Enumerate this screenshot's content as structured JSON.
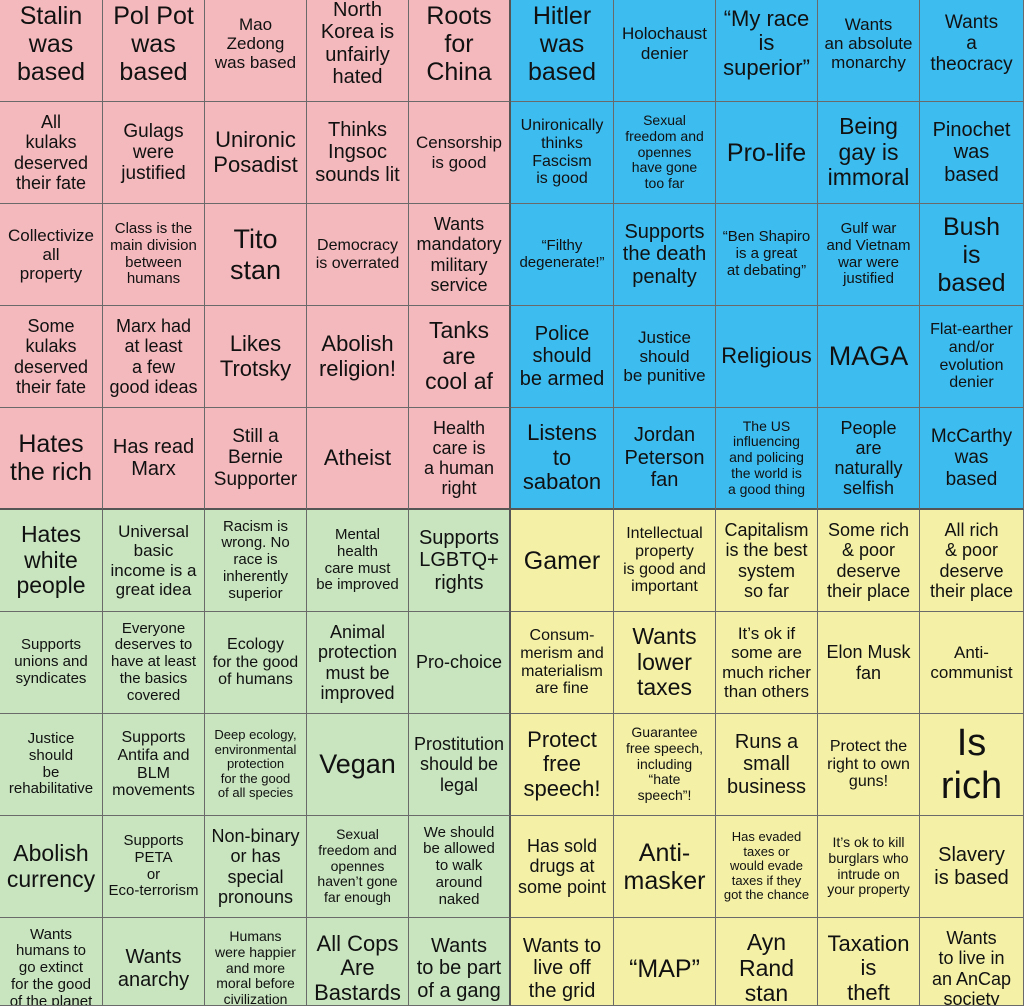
{
  "colors": {
    "red": "#f4b9bd",
    "blue": "#3dbcf0",
    "green": "#c8e5bf",
    "yellow": "#f4f1a7"
  },
  "rows": [
    [
      "Stalin\nwas\nbased",
      "Pol Pot\nwas\nbased",
      "Mao\nZedong\nwas based",
      "North\nKorea is\nunfairly\nhated",
      "Roots\nfor\nChina",
      "Hitler\nwas\nbased",
      "Holochaust\ndenier",
      "“My race\nis\nsuperior”",
      "Wants\nan absolute\nmonarchy",
      "Wants\na\ntheocracy"
    ],
    [
      "All\nkulaks\ndeserved\ntheir fate",
      "Gulags\nwere\njustified",
      "Unironic\nPosadist",
      "Thinks\nIngsoc\nsounds lit",
      "Censorship\nis good",
      "Unironically\nthinks\nFascism\nis good",
      "Sexual\nfreedom and\nopennes\nhave gone\ntoo far",
      "Pro-life",
      "Being\ngay is\nimmoral",
      "Pinochet\nwas\nbased"
    ],
    [
      "Collectivize\nall\nproperty",
      "Class is the\nmain division\nbetween\nhumans",
      "Tito\nstan",
      "Democracy\nis overrated",
      "Wants\nmandatory\nmilitary\nservice",
      "“Filthy\ndegenerate!”",
      "Supports\nthe death\npenalty",
      "“Ben Shapiro\nis a great\nat debating”",
      "Gulf war\nand Vietnam\nwar were\njustified",
      "Bush\nis\nbased"
    ],
    [
      "Some\nkulaks\ndeserved\ntheir fate",
      "Marx had\nat least\na few\ngood ideas",
      "Likes\nTrotsky",
      "Abolish\nreligion!",
      "Tanks\nare\ncool af",
      "Police\nshould\nbe armed",
      "Justice\nshould\nbe punitive",
      "Religious",
      "MAGA",
      "Flat-earther\nand/or\nevolution\ndenier"
    ],
    [
      "Hates\nthe rich",
      "Has read\nMarx",
      "Still a\nBernie\nSupporter",
      "Atheist",
      "Health\ncare is\na human\nright",
      "Listens\nto\nsabaton",
      "Jordan\nPeterson\nfan",
      "The US\ninfluencing\nand policing\nthe world is\na good thing",
      "People\nare\nnaturally\nselfish",
      "McCarthy\nwas\nbased"
    ],
    [
      "Hates\nwhite\npeople",
      "Universal\nbasic\nincome is a\ngreat idea",
      "Racism is\nwrong. No\nrace is\ninherently\nsuperior",
      "Mental\nhealth\ncare must\nbe improved",
      "Supports\nLGBTQ+\nrights",
      "Gamer",
      "Intellectual\nproperty\nis good and\nimportant",
      "Capitalism\nis the best\nsystem\nso far",
      "Some rich\n& poor\ndeserve\ntheir place",
      "All rich\n& poor\ndeserve\ntheir place"
    ],
    [
      "Supports\nunions and\nsyndicates",
      "Everyone\ndeserves to\nhave at least\nthe basics\ncovered",
      "Ecology\nfor the good\nof humans",
      "Animal\nprotection\nmust be\nimproved",
      "Pro-choice",
      "Consum-\nmerism and\nmaterialism\nare fine",
      "Wants\nlower\ntaxes",
      "It’s ok if\nsome are\nmuch richer\nthan others",
      "Elon Musk\nfan",
      "Anti-\ncommunist"
    ],
    [
      "Justice\nshould\nbe\nrehabilitative",
      "Supports\nAntifa and\nBLM\nmovements",
      "Deep ecology,\nenvironmental\nprotection\nfor the good\nof all species",
      "Vegan",
      "Prostitution\nshould be\nlegal",
      "Protect\nfree\nspeech!",
      "Guarantee\nfree speech,\nincluding\n“hate\nspeech”!",
      "Runs a\nsmall\nbusiness",
      "Protect the\nright to own\nguns!",
      "Is\nrich"
    ],
    [
      "Abolish\ncurrency",
      "Supports\nPETA\nor\nEco-terrorism",
      "Non-binary\nor has\nspecial\npronouns",
      "Sexual\nfreedom and\nopennes\nhaven’t gone\nfar enough",
      "We should\nbe allowed\nto walk\naround\nnaked",
      "Has sold\ndrugs at\nsome point",
      "Anti-\nmasker",
      "Has evaded\ntaxes or\nwould evade\ntaxes if they\ngot the chance",
      "It’s ok to kill\nburglars who\nintrude on\nyour property",
      "Slavery\nis based"
    ],
    [
      "Wants\nhumans to\ngo extinct\nfor the good\nof the planet",
      "Wants\nanarchy",
      "Humans\nwere happier\nand more\nmoral before\ncivilization",
      "All Cops\nAre\nBastards",
      "Wants\nto be part\nof a gang",
      "Wants to\nlive off\nthe grid",
      "“MAP”",
      "Ayn\nRand\nstan",
      "Taxation\nis\ntheft",
      "Wants\nto live in\nan AnCap\nsociety"
    ]
  ]
}
